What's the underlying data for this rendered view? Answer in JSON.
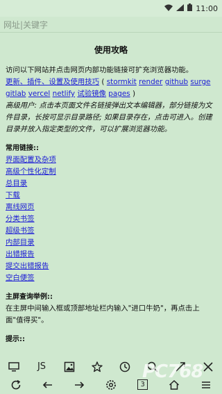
{
  "statusbar": {
    "time": "11:00"
  },
  "address": {
    "placeholder": "网址|关键字"
  },
  "page": {
    "title": "使用攻略",
    "intro": "访问以下网站并点击网页内部功能链接可扩充浏览器功能。",
    "site_links": [
      {
        "label": "更新、插件、设置及使用技巧"
      },
      {
        "label": "stormkit"
      },
      {
        "label": "render"
      },
      {
        "label": "github"
      },
      {
        "label": "surge"
      },
      {
        "label": "gitlab"
      },
      {
        "label": "vercel"
      },
      {
        "label": "netlify"
      },
      {
        "label": "试验镜像"
      },
      {
        "label": "pages"
      }
    ],
    "advanced_note": "高级用户: 点击本页面文件名链接弹出文本编辑器，部分链接为文件目录，长按可显示目录路径; 如果目录存在，点击可进入。创建目录并放入指定类型的文件，可以扩展浏览器功能。",
    "common_links_title": "常用链接::",
    "common_links": [
      "界面配置及杂项",
      "高级个性化定制",
      "总目录",
      "下载",
      "离线网页",
      "分类书签",
      "超级书签",
      "内部目录",
      "出错报告",
      "提交出错报告",
      "空白便签"
    ],
    "faq_title": "主屏查询举例::",
    "faq_text": "在主屏中间输入框或顶部地址栏内输入\"进口牛奶\"，再点击上面\"值得买\"。",
    "tips_title": "提示::"
  },
  "toolbar_top": [
    {
      "name": "desktop-icon"
    },
    {
      "name": "js-button",
      "label": "JS"
    },
    {
      "name": "image-icon"
    },
    {
      "name": "star-icon"
    },
    {
      "name": "clock-icon"
    },
    {
      "name": "search-icon"
    },
    {
      "name": "share-icon"
    },
    {
      "name": "close-icon"
    }
  ],
  "toolbar_bottom": [
    {
      "name": "refresh-icon"
    },
    {
      "name": "back-icon"
    },
    {
      "name": "forward-icon"
    },
    {
      "name": "gear-icon"
    },
    {
      "name": "tabs-count",
      "label": "3"
    },
    {
      "name": "home-icon"
    },
    {
      "name": "menu-icon"
    }
  ],
  "watermark": {
    "text": "PC768"
  }
}
